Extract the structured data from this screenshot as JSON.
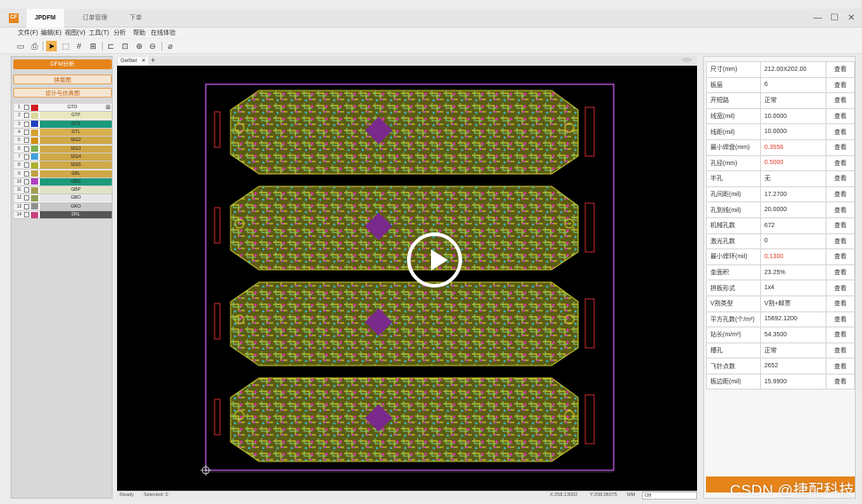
{
  "titlebar": {
    "logo": "CF",
    "tabs": [
      "JPDFM",
      "订单管理",
      "下单"
    ],
    "window_controls": [
      "—",
      "☐",
      "✕"
    ]
  },
  "menu": [
    "文件(F)",
    "编辑(E)",
    "视图(V)",
    "工具(T)",
    "分析",
    "帮助",
    "在线体验"
  ],
  "toolbar": {
    "icons": [
      "folder-open-icon",
      "print-icon",
      "select-pointer-icon",
      "select-area-icon",
      "grid-icon",
      "table-icon",
      "align-icon",
      "fit-icon",
      "zoom-in-icon",
      "zoom-out-icon",
      "measure-icon"
    ]
  },
  "left": {
    "buttons": [
      "DFM分析",
      "拼版图",
      "设计与仿真图"
    ],
    "layers": [
      {
        "n": "1",
        "name": "GTO",
        "color": "#d22020",
        "bg": "#f4f4f4"
      },
      {
        "n": "2",
        "name": "GTP",
        "color": "#d9d99a",
        "bg": "#e9e9c0"
      },
      {
        "n": "3",
        "name": "GTS",
        "color": "#2040c0",
        "bg": "#1c9a7a"
      },
      {
        "n": "4",
        "name": "GTL",
        "color": "#d7a030",
        "bg": "#d8b050"
      },
      {
        "n": "5",
        "name": "SIG2",
        "color": "#d09010",
        "bg": "#d0a848"
      },
      {
        "n": "6",
        "name": "SIG3",
        "color": "#7ab050",
        "bg": "#d0a848"
      },
      {
        "n": "7",
        "name": "SIG4",
        "color": "#40a0e0",
        "bg": "#d0a848"
      },
      {
        "n": "8",
        "name": "SIG5",
        "color": "#b0b030",
        "bg": "#d0a848"
      },
      {
        "n": "9",
        "name": "GBL",
        "color": "#c0a040",
        "bg": "#d0a848"
      },
      {
        "n": "10",
        "name": "GBS",
        "color": "#b040c0",
        "bg": "#1c9a7a"
      },
      {
        "n": "11",
        "name": "GBP",
        "color": "#a0a050",
        "bg": "#e2e2c8"
      },
      {
        "n": "12",
        "name": "GBO",
        "color": "#90a050",
        "bg": "#e6e6e6"
      },
      {
        "n": "13",
        "name": "GKO",
        "color": "#909090",
        "bg": "#c8c8c8"
      },
      {
        "n": "14",
        "name": "DRL",
        "color": "#c84080",
        "bg": "#555555"
      }
    ],
    "layer_plus": "⊞"
  },
  "center": {
    "tab": "Gerber",
    "tab_close": "✕",
    "add": "+",
    "nav": "◁ ▷",
    "status": {
      "ready": "Ready",
      "selected": "Selected: 0",
      "x": "X:258.13002",
      "y": "Y:208.06075",
      "unit": "MM",
      "unit_value": "Off"
    }
  },
  "props": [
    {
      "k": "尺寸(mm)",
      "v": "212.00X202.00",
      "a": "查看",
      "red": false
    },
    {
      "k": "板层",
      "v": "6",
      "a": "查看",
      "red": false
    },
    {
      "k": "开短路",
      "v": "正常",
      "a": "查看",
      "red": false
    },
    {
      "k": "线宽(mil)",
      "v": "10.0000",
      "a": "查看",
      "red": false
    },
    {
      "k": "线距(mil)",
      "v": "10.0000",
      "a": "查看",
      "red": false
    },
    {
      "k": "最小焊盘(mm)",
      "v": "0.3556",
      "a": "查看",
      "red": true
    },
    {
      "k": "孔径(mm)",
      "v": "0.5000",
      "a": "查看",
      "red": true
    },
    {
      "k": "半孔",
      "v": "无",
      "a": "查看",
      "red": false
    },
    {
      "k": "孔间距(mil)",
      "v": "17.2700",
      "a": "查看",
      "red": false
    },
    {
      "k": "孔到线(mil)",
      "v": "20.0000",
      "a": "查看",
      "red": false
    },
    {
      "k": "机械孔数",
      "v": "672",
      "a": "查看",
      "red": false
    },
    {
      "k": "激光孔数",
      "v": "0",
      "a": "查看",
      "red": false
    },
    {
      "k": "最小焊环(mil)",
      "v": "0.1300",
      "a": "查看",
      "red": true
    },
    {
      "k": "金面积",
      "v": "23.25%",
      "a": "查看",
      "red": false
    },
    {
      "k": "拼板形式",
      "v": "1x4",
      "a": "查看",
      "red": false
    },
    {
      "k": "V割类型",
      "v": "V割+邮票",
      "a": "查看",
      "red": false
    },
    {
      "k": "平方孔数(个/m²)",
      "v": "15692.1200",
      "a": "查看",
      "red": false
    },
    {
      "k": "钻长(m/m²)",
      "v": "54.3500",
      "a": "查看",
      "red": false
    },
    {
      "k": "槽孔",
      "v": "正常",
      "a": "查看",
      "red": false
    },
    {
      "k": "飞针点数",
      "v": "2652",
      "a": "查看",
      "red": false
    },
    {
      "k": "板边距(mil)",
      "v": "15.9900",
      "a": "查看",
      "red": false
    }
  ],
  "watermark": "CSDN @捷配科技"
}
